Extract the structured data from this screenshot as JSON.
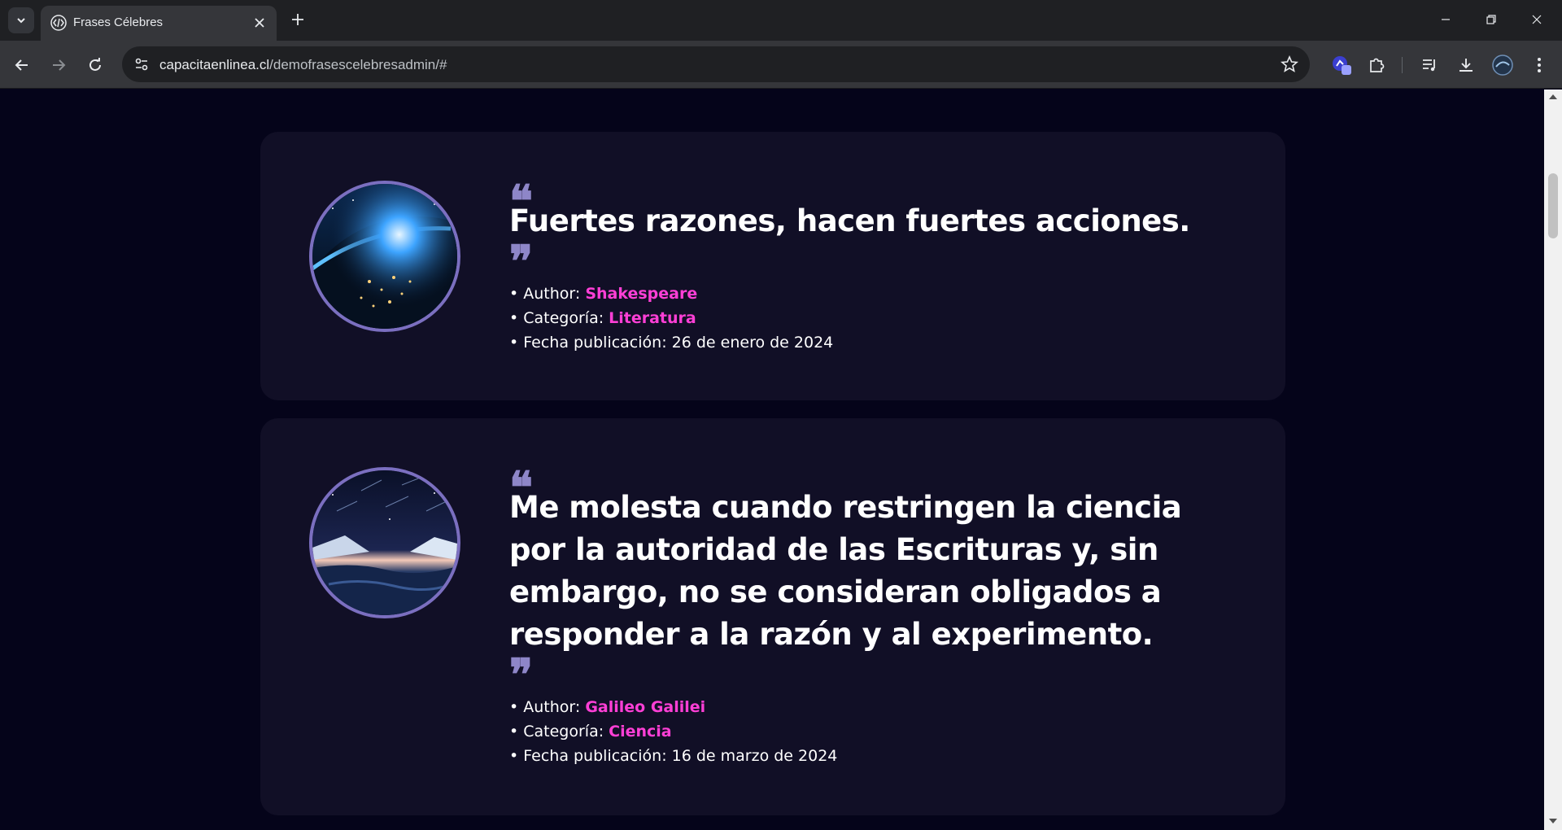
{
  "browser": {
    "tab_title": "Frases Célebres",
    "url_host": "capacitaenlinea.cl",
    "url_path": "/demofrasescelebresadmin/#"
  },
  "quotes": [
    {
      "text": "Fuertes razones, hacen fuertes acciones.",
      "author_label": "• Author: ",
      "author": "Shakespeare",
      "category_label": "• Categoría: ",
      "category": "Literatura",
      "date_label": "• Fecha publicación: ",
      "date": "26 de enero de 2024",
      "image": "earth-from-space"
    },
    {
      "text": "Me molesta cuando restringen la ciencia por la autoridad de las Escrituras y, sin embargo, no se consideran obligados a responder a la razón y al experimento.",
      "author_label": "• Author: ",
      "author": "Galileo Galilei",
      "category_label": "• Categoría: ",
      "category": "Ciencia",
      "date_label": "• Fecha publicación: ",
      "date": "16 de marzo de 2024",
      "image": "night-sky-over-sea"
    }
  ],
  "colors": {
    "page_bg": "#05041a",
    "card_bg": "#110f26",
    "accent": "#ff3fd6",
    "quote_mark": "#8e86c8",
    "avatar_border": "#7b6fc0"
  }
}
